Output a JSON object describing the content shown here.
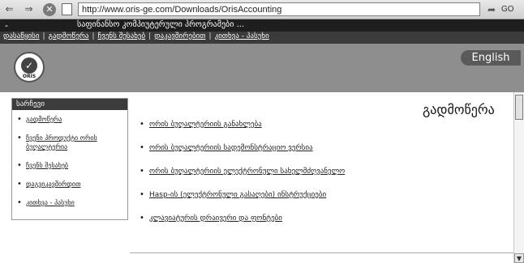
{
  "browser": {
    "url": "http://www.oris-ge.com/Downloads/OrisAccounting",
    "go_label": "GO",
    "icons": [
      "back-arrow-icon",
      "forward-arrow-icon",
      "stop-icon",
      "page-icon",
      "go-arrow-icon"
    ]
  },
  "site": {
    "title_dash": "-",
    "title": "საფინანსო კომპიუტერული პროგრამები ...",
    "menu": [
      "დასაწყისი",
      "გადმოწერა",
      "ჩვენს შესახებ",
      "დაკავშირებით",
      "კითხვა - პასუხი"
    ],
    "logo_text": "ORIS",
    "english_label": "English"
  },
  "sidebar": {
    "header": "სარჩევი",
    "items": [
      {
        "label": "გადმოწერა",
        "link": true
      },
      {
        "label": "ჩვენი პროდუქტი ორის ბუღალტერია",
        "link": true
      },
      {
        "label": "ჩვენს შესახებ",
        "link": true
      },
      {
        "label": "დაგვიკავშირდით",
        "link": true
      },
      {
        "label": "კითხვა - პასუხი",
        "link": true
      }
    ]
  },
  "main": {
    "title": "გადმოწერა",
    "links": [
      "ორის ბუღალტერიის განახლება",
      "ორის ბუღალტერიის სადემონსტრაციო ვერსია",
      "ორის ბუღალტერიის ელექტრონული სახელმძღვანელო",
      "Hasp-ის (ელექტრონული გასაღები) ინსტრუქციები",
      "კლავიატურის დრაივერი და ფონტები"
    ]
  },
  "colors": {
    "title_bar": "#1e1e1e",
    "menu_bar": "#3b3b3b",
    "header_band": "#8e8e8e",
    "english_button": "#5a5a5a",
    "sidebar_header": "#3c3c3c"
  }
}
